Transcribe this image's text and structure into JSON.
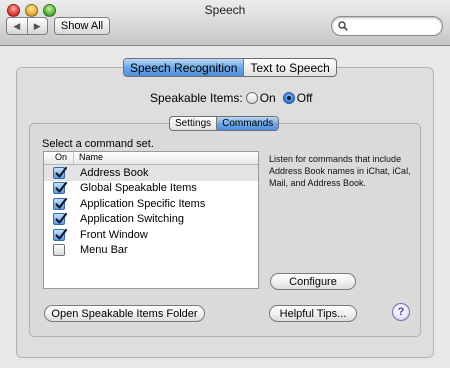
{
  "window": {
    "title": "Speech"
  },
  "toolbar": {
    "back_glyph": "◀",
    "forward_glyph": "▶",
    "show_all_label": "Show All",
    "search": {
      "value": "",
      "placeholder": ""
    }
  },
  "main_tabs": [
    {
      "label": "Speech Recognition",
      "selected": true
    },
    {
      "label": "Text to Speech",
      "selected": false
    }
  ],
  "speakable": {
    "label": "Speakable Items:",
    "on_label": "On",
    "off_label": "Off",
    "selected": "Off"
  },
  "sub_tabs": [
    {
      "label": "Settings",
      "selected": false
    },
    {
      "label": "Commands",
      "selected": true
    }
  ],
  "commands": {
    "prompt": "Select a command set.",
    "columns": {
      "on": "On",
      "name": "Name"
    },
    "rows": [
      {
        "checked": true,
        "name": "Address Book"
      },
      {
        "checked": true,
        "name": "Global Speakable Items"
      },
      {
        "checked": true,
        "name": "Application Specific Items"
      },
      {
        "checked": true,
        "name": "Application Switching"
      },
      {
        "checked": true,
        "name": "Front Window"
      },
      {
        "checked": false,
        "name": "Menu Bar"
      }
    ],
    "selected_index": 0,
    "description": "Listen for commands that include Address Book names in iChat, iCal, Mail, and Address Book.",
    "configure_label": "Configure"
  },
  "footer": {
    "open_folder_label": "Open Speakable Items Folder",
    "helpful_tips_label": "Helpful Tips...",
    "help_glyph": "?"
  },
  "colors": {
    "selected_segment": "#6fa9e7",
    "checkbox_checked": "#5f9de0",
    "window_background": "#e8e8e8"
  }
}
